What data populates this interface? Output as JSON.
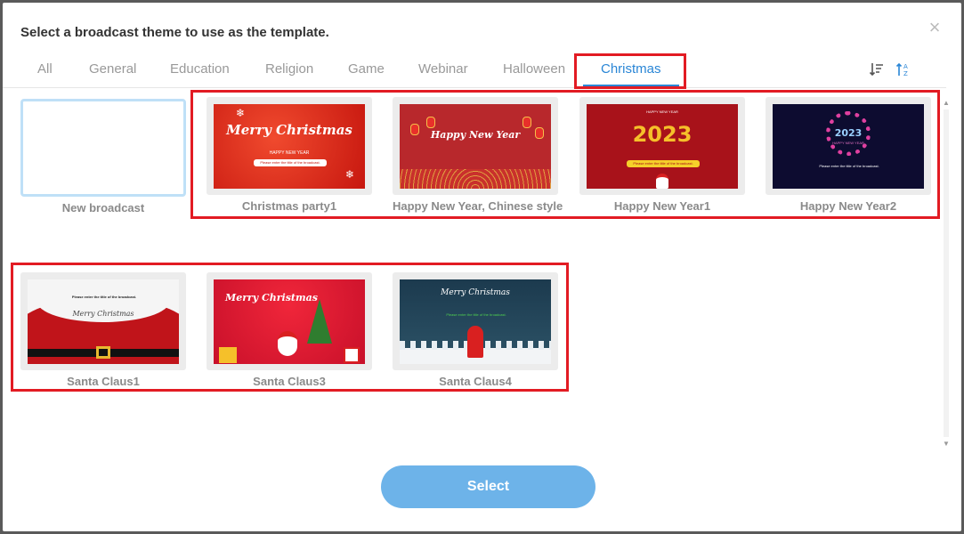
{
  "dialog": {
    "title": "Select a broadcast theme to use as the template.",
    "close_glyph": "×"
  },
  "tabs": [
    {
      "label": "All",
      "active": false
    },
    {
      "label": "General",
      "active": false
    },
    {
      "label": "Education",
      "active": false
    },
    {
      "label": "Religion",
      "active": false
    },
    {
      "label": "Game",
      "active": false
    },
    {
      "label": "Webinar",
      "active": false
    },
    {
      "label": "Halloween",
      "active": false
    },
    {
      "label": "Christmas",
      "active": true
    }
  ],
  "sort_icons": [
    "sort-descending-icon",
    "sort-alpha-ascending-icon"
  ],
  "themes": [
    {
      "label": "New broadcast"
    },
    {
      "label": "Christmas party1",
      "thumb_text": "Merry Christmas",
      "thumb_sub": "HAPPY NEW YEAR",
      "bar_text": "Please enter the title of the broadcast."
    },
    {
      "label": "Happy New Year, Chinese style",
      "thumb_text": "Happy New Year"
    },
    {
      "label": "Happy New Year1",
      "thumb_text": "2023",
      "bar_text": "Please enter the title of the broadcast.",
      "thumb_sub": "HAPPY NEW YEAR"
    },
    {
      "label": "Happy New Year2",
      "thumb_text": "2023",
      "thumb_sub": "HAPPY NEW YEAR",
      "bar_text": "Please enter the title of the broadcast."
    },
    {
      "label": "Santa Claus1",
      "thumb_text": "Merry Christmas",
      "bar_text": "Please enter the title of the broadcast."
    },
    {
      "label": "Santa Claus3",
      "thumb_text": "Merry Christmas"
    },
    {
      "label": "Santa Claus4",
      "thumb_text": "Merry Christmas",
      "bar_text": "Please enter the title of the broadcast."
    }
  ],
  "select_button": "Select",
  "colors": {
    "accent": "#2a86d6",
    "highlight": "#e21b23",
    "button": "#6db3e9"
  }
}
